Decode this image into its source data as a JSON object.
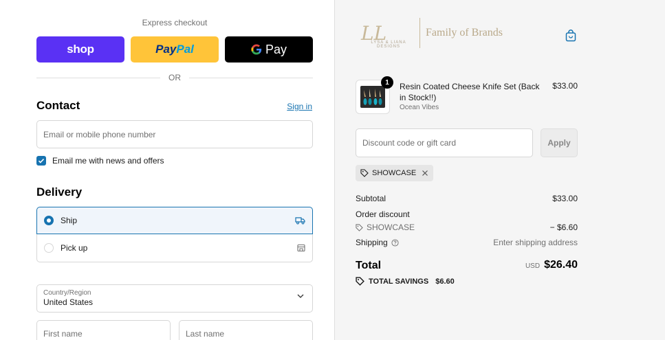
{
  "express": {
    "title": "Express checkout",
    "shop_label": "shop",
    "paypal_part1": "Pay",
    "paypal_part2": "Pal",
    "gpay_label": "Pay",
    "or_label": "OR"
  },
  "contact": {
    "title": "Contact",
    "signin_label": "Sign in",
    "email_placeholder": "Email or mobile phone number",
    "newsletter_label": "Email me with news and offers",
    "newsletter_checked": true
  },
  "delivery": {
    "title": "Delivery",
    "options": [
      {
        "label": "Ship",
        "selected": true,
        "icon": "truck-icon"
      },
      {
        "label": "Pick up",
        "selected": false,
        "icon": "store-icon"
      }
    ],
    "country_label": "Country/Region",
    "country_value": "United States",
    "first_name_placeholder": "First name",
    "last_name_placeholder": "Last name"
  },
  "brand": {
    "monogram": "LL",
    "monogram_sub": "LYSA & LIANA DESIGNS",
    "family_label": "Family of Brands"
  },
  "cart": {
    "item": {
      "quantity": "1",
      "name": "Resin Coated Cheese Knife Set (Back in Stock!!)",
      "variant": "Ocean Vibes",
      "price": "$33.00"
    },
    "discount_placeholder": "Discount code or gift card",
    "apply_label": "Apply",
    "applied_code": "SHOWCASE"
  },
  "summary": {
    "subtotal_label": "Subtotal",
    "subtotal_value": "$33.00",
    "order_discount_label": "Order discount",
    "discount_code": "SHOWCASE",
    "discount_value": "− $6.60",
    "shipping_label": "Shipping",
    "shipping_value": "Enter shipping address",
    "total_label": "Total",
    "currency": "USD",
    "total_value": "$26.40",
    "savings_label": "TOTAL SAVINGS",
    "savings_value": "$6.60"
  },
  "colors": {
    "accent": "#1773b0",
    "shop_purple": "#5a31f4",
    "paypal_yellow": "#ffc439",
    "sidebar_bg": "#f5f5f5"
  }
}
